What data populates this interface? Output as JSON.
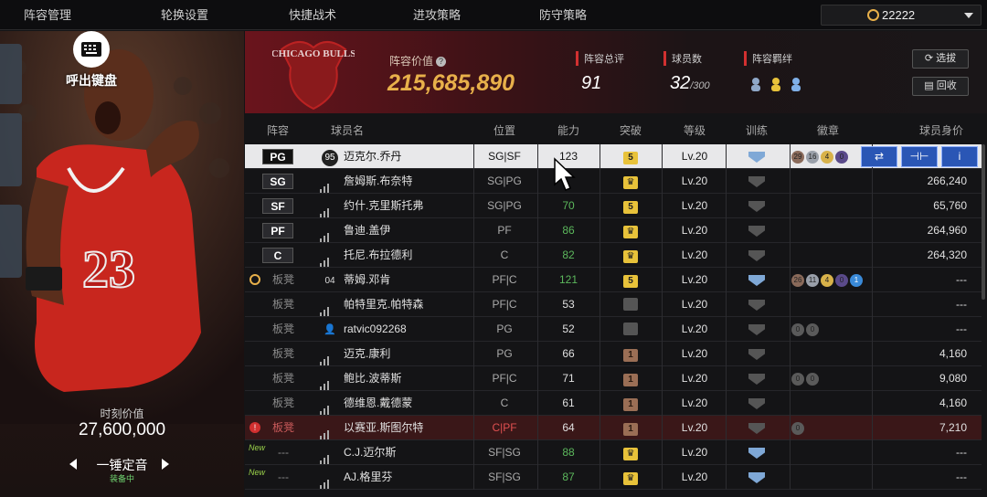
{
  "nav": {
    "tabs": [
      {
        "label": "阵容管理",
        "active": true
      },
      {
        "label": "轮换设置",
        "active": false
      },
      {
        "label": "快捷战术",
        "active": false
      },
      {
        "label": "进攻策略",
        "active": false
      },
      {
        "label": "防守策略",
        "active": false
      }
    ],
    "coins": "22222"
  },
  "left": {
    "keyboard_label": "呼出键盘",
    "moment_value_label": "时刻价值",
    "moment_value": "27,600,000",
    "skill_name": "一锤定音",
    "skill_status": "装备中"
  },
  "summary": {
    "team_logo_text": "CHICAGO BULLS",
    "lineup_value_label": "阵容价值",
    "lineup_value": "215,685,890",
    "total_rating_label": "阵容总评",
    "total_rating": "91",
    "player_count_label": "球员数",
    "player_count": "32",
    "player_count_max": "/300",
    "bonds_label": "阵容羁绊",
    "pick_button": "选拔",
    "recycle_button": "回收"
  },
  "table": {
    "headers": [
      "阵容",
      "球员名",
      "位置",
      "能力",
      "突破",
      "等级",
      "训练",
      "徽章",
      "球员身价"
    ],
    "rows": [
      {
        "slot": "PG",
        "starter": true,
        "icon": "95",
        "name": "迈克尔.乔丹",
        "pos": "SG|SF",
        "ovr": "123",
        "ovr_color": "normal",
        "breakthrough": "5",
        "brk_style": "gold",
        "level": "Lv.20",
        "train_color": "#7fa8d6",
        "badges": [
          "29",
          "16",
          "4",
          "0"
        ],
        "value": "",
        "selected": true
      },
      {
        "slot": "SG",
        "starter": true,
        "icon": "signal",
        "name": "詹姆斯.布奈特",
        "pos": "SG|PG",
        "ovr": "",
        "ovr_color": "normal",
        "breakthrough": "crown",
        "brk_style": "gold",
        "level": "Lv.20",
        "train_color": "#555",
        "badges": [],
        "value": "266,240"
      },
      {
        "slot": "SF",
        "starter": true,
        "icon": "signal",
        "name": "约什.克里斯托弗",
        "pos": "SG|PG",
        "ovr": "70",
        "ovr_color": "green",
        "breakthrough": "5",
        "brk_style": "gold",
        "level": "Lv.20",
        "train_color": "#555",
        "badges": [],
        "value": "65,760"
      },
      {
        "slot": "PF",
        "starter": true,
        "icon": "signal",
        "name": "鲁迪.盖伊",
        "pos": "PF",
        "ovr": "86",
        "ovr_color": "green",
        "breakthrough": "crown",
        "brk_style": "gold",
        "level": "Lv.20",
        "train_color": "#555",
        "badges": [],
        "value": "264,960"
      },
      {
        "slot": "C",
        "starter": true,
        "icon": "signal",
        "name": "托尼.布拉德利",
        "pos": "C",
        "ovr": "82",
        "ovr_color": "green",
        "breakthrough": "crown",
        "brk_style": "gold",
        "level": "Lv.20",
        "train_color": "#555",
        "badges": [],
        "value": "264,320"
      },
      {
        "slot": "板凳",
        "starter": false,
        "marker": "coin",
        "icon": "04",
        "name": "蒂姆.邓肯",
        "pos": "PF|C",
        "ovr": "121",
        "ovr_color": "green",
        "breakthrough": "5",
        "brk_style": "gold",
        "level": "Lv.20",
        "train_color": "#7fa8d6",
        "badges": [
          "26",
          "11",
          "4",
          "0",
          "1"
        ],
        "value": "---"
      },
      {
        "slot": "板凳",
        "starter": false,
        "icon": "signal",
        "name": "帕特里克.帕特森",
        "pos": "PF|C",
        "ovr": "53",
        "ovr_color": "normal",
        "breakthrough": "-",
        "brk_style": "grey",
        "level": "Lv.20",
        "train_color": "#555",
        "badges": [],
        "value": "---"
      },
      {
        "slot": "板凳",
        "starter": false,
        "icon": "user",
        "name": "ratvic092268",
        "pos": "PG",
        "ovr": "52",
        "ovr_color": "normal",
        "breakthrough": "-",
        "brk_style": "grey",
        "level": "Lv.20",
        "train_color": "#555",
        "badges": [
          "0",
          "0"
        ],
        "value": "---"
      },
      {
        "slot": "板凳",
        "starter": false,
        "icon": "signal",
        "name": "迈克.康利",
        "pos": "PG",
        "ovr": "66",
        "ovr_color": "normal",
        "breakthrough": "1",
        "brk_style": "bronze",
        "level": "Lv.20",
        "train_color": "#555",
        "badges": [],
        "value": "4,160"
      },
      {
        "slot": "板凳",
        "starter": false,
        "icon": "signal",
        "name": "鲍比.波蒂斯",
        "pos": "PF|C",
        "ovr": "71",
        "ovr_color": "normal",
        "breakthrough": "1",
        "brk_style": "bronze",
        "level": "Lv.20",
        "train_color": "#555",
        "badges": [
          "0",
          "0"
        ],
        "value": "9,080"
      },
      {
        "slot": "板凳",
        "starter": false,
        "icon": "signal",
        "name": "德维恩.戴德蒙",
        "pos": "C",
        "ovr": "61",
        "ovr_color": "normal",
        "breakthrough": "1",
        "brk_style": "bronze",
        "level": "Lv.20",
        "train_color": "#555",
        "badges": [],
        "value": "4,160"
      },
      {
        "slot": "板凳",
        "starter": false,
        "marker": "alert",
        "warn": true,
        "icon": "signal",
        "name": "以赛亚.斯图尔特",
        "pos": "C|PF",
        "ovr": "64",
        "ovr_color": "normal",
        "breakthrough": "1",
        "brk_style": "bronze",
        "level": "Lv.20",
        "train_color": "#555",
        "badges": [
          "0"
        ],
        "value": "7,210"
      },
      {
        "slot": "---",
        "starter": false,
        "marker": "new",
        "new_label": "New",
        "icon": "signal",
        "name": "C.J.迈尔斯",
        "pos": "SF|SG",
        "ovr": "88",
        "ovr_color": "green",
        "breakthrough": "crown",
        "brk_style": "gold",
        "level": "Lv.20",
        "train_color": "#7fa8d6",
        "badges": [],
        "value": "---"
      },
      {
        "slot": "---",
        "starter": false,
        "marker": "new",
        "new_label": "New",
        "icon": "signal",
        "name": "AJ.格里芬",
        "pos": "SF|SG",
        "ovr": "87",
        "ovr_color": "green",
        "breakthrough": "crown",
        "brk_style": "gold",
        "level": "Lv.20",
        "train_color": "#7fa8d6",
        "badges": [],
        "value": "---"
      }
    ]
  },
  "badge_colors": [
    "#8a6a5a",
    "#9aa0aa",
    "#d8b24a",
    "#5a4a8a",
    "#3a8ad8"
  ],
  "colors": {
    "accent": "#e8b04a",
    "warn_row": "#3a1718",
    "selected_row": "#e8e8ea",
    "action_blue": "#2a56b5"
  }
}
